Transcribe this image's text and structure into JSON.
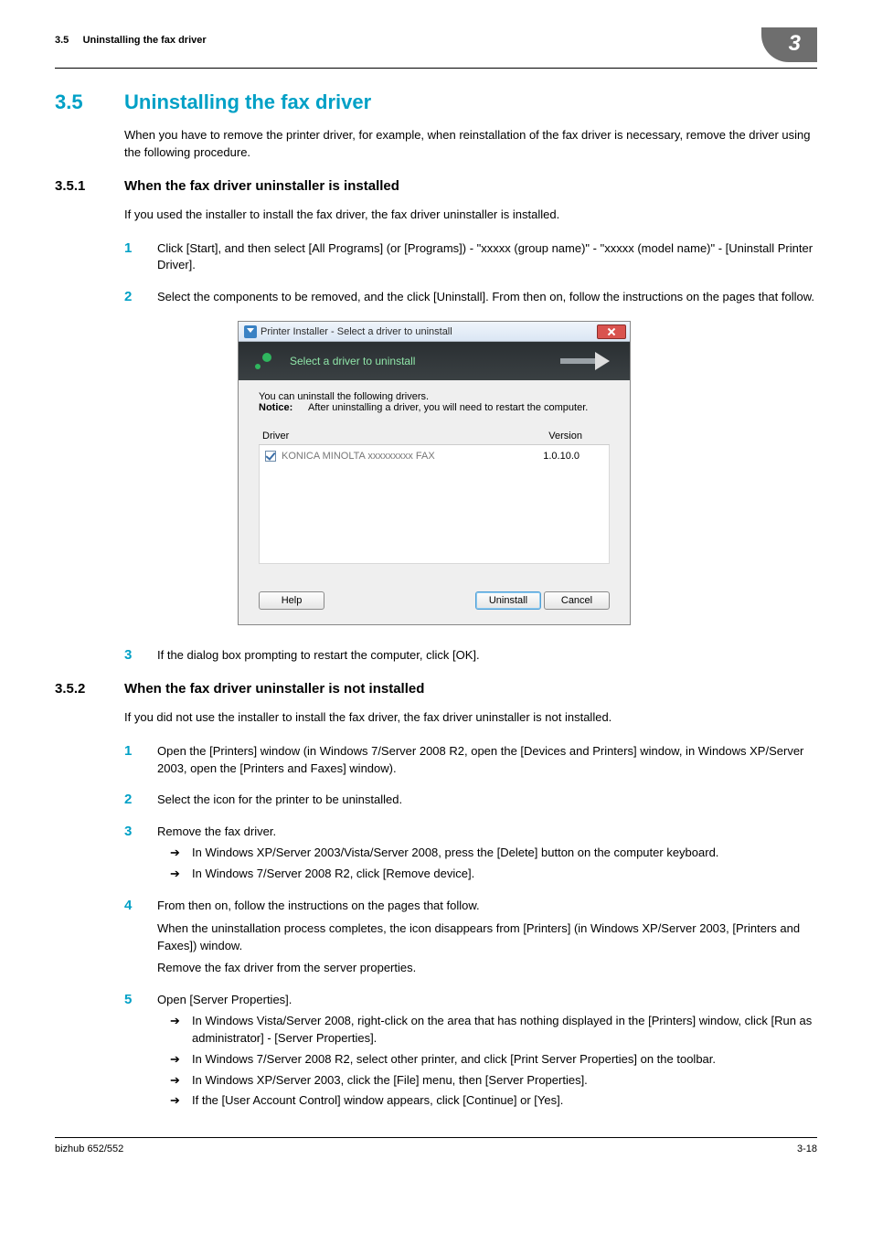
{
  "header": {
    "section_ref": "3.5",
    "running_title": "Uninstalling the fax driver",
    "chapter_badge": "3"
  },
  "h1": {
    "num": "3.5",
    "title": "Uninstalling the fax driver"
  },
  "intro": "When you have to remove the printer driver, for example, when reinstallation of the fax driver is necessary, remove the driver using the following procedure.",
  "s351": {
    "num": "3.5.1",
    "title": "When the fax driver uninstaller is installed",
    "lead": "If you used the installer to install the fax driver, the fax driver uninstaller is installed.",
    "step1": "Click [Start], and then select [All Programs] (or [Programs]) - \"xxxxx (group name)\" - \"xxxxx (model name)\" - [Uninstall Printer Driver].",
    "step2": "Select the components to be removed, and the click [Uninstall]. From then on, follow the instructions on the pages that follow.",
    "step3": "If the dialog box prompting to restart the computer, click [OK]."
  },
  "dialog": {
    "title": "Printer Installer - Select a driver to uninstall",
    "banner": "Select a driver to uninstall",
    "notice_line1": "You can uninstall the following drivers.",
    "notice_label": "Notice:",
    "notice_line2": "After uninstalling a driver, you will need to restart the computer.",
    "col_driver": "Driver",
    "col_version": "Version",
    "driver_name": "KONICA MINOLTA xxxxxxxxx FAX",
    "driver_version": "1.0.10.0",
    "btn_help": "Help",
    "btn_uninstall": "Uninstall",
    "btn_cancel": "Cancel"
  },
  "s352": {
    "num": "3.5.2",
    "title": "When the fax driver uninstaller is not installed",
    "lead": "If you did not use the installer to install the fax driver, the fax driver uninstaller is not installed.",
    "step1": "Open the [Printers] window (in Windows 7/Server 2008 R2, open the [Devices and Printers] window, in Windows XP/Server 2003, open the [Printers and Faxes] window).",
    "step2": "Select the icon for the printer to be uninstalled.",
    "step3": "Remove the fax driver.",
    "step3_sub1": "In Windows XP/Server 2003/Vista/Server 2008, press the [Delete] button on the computer keyboard.",
    "step3_sub2": "In Windows 7/Server 2008 R2, click [Remove device].",
    "step4": "From then on, follow the instructions on the pages that follow.",
    "step4_note1": "When the uninstallation process completes, the icon disappears from [Printers] (in Windows XP/Server 2003, [Printers and Faxes]) window.",
    "step4_note2": "Remove the fax driver from the server properties.",
    "step5": "Open [Server Properties].",
    "step5_sub1": "In Windows Vista/Server 2008, right-click on the area that has nothing displayed in the [Printers] window, click [Run as administrator] - [Server Properties].",
    "step5_sub2": "In Windows 7/Server 2008 R2, select other printer, and click [Print Server Properties] on the toolbar.",
    "step5_sub3": "In Windows XP/Server 2003, click the [File] menu, then [Server Properties].",
    "step5_sub4": "If the [User Account Control] window appears, click [Continue] or [Yes]."
  },
  "footer": {
    "left": "bizhub 652/552",
    "right": "3-18"
  },
  "glyphs": {
    "arrow": "➔"
  }
}
